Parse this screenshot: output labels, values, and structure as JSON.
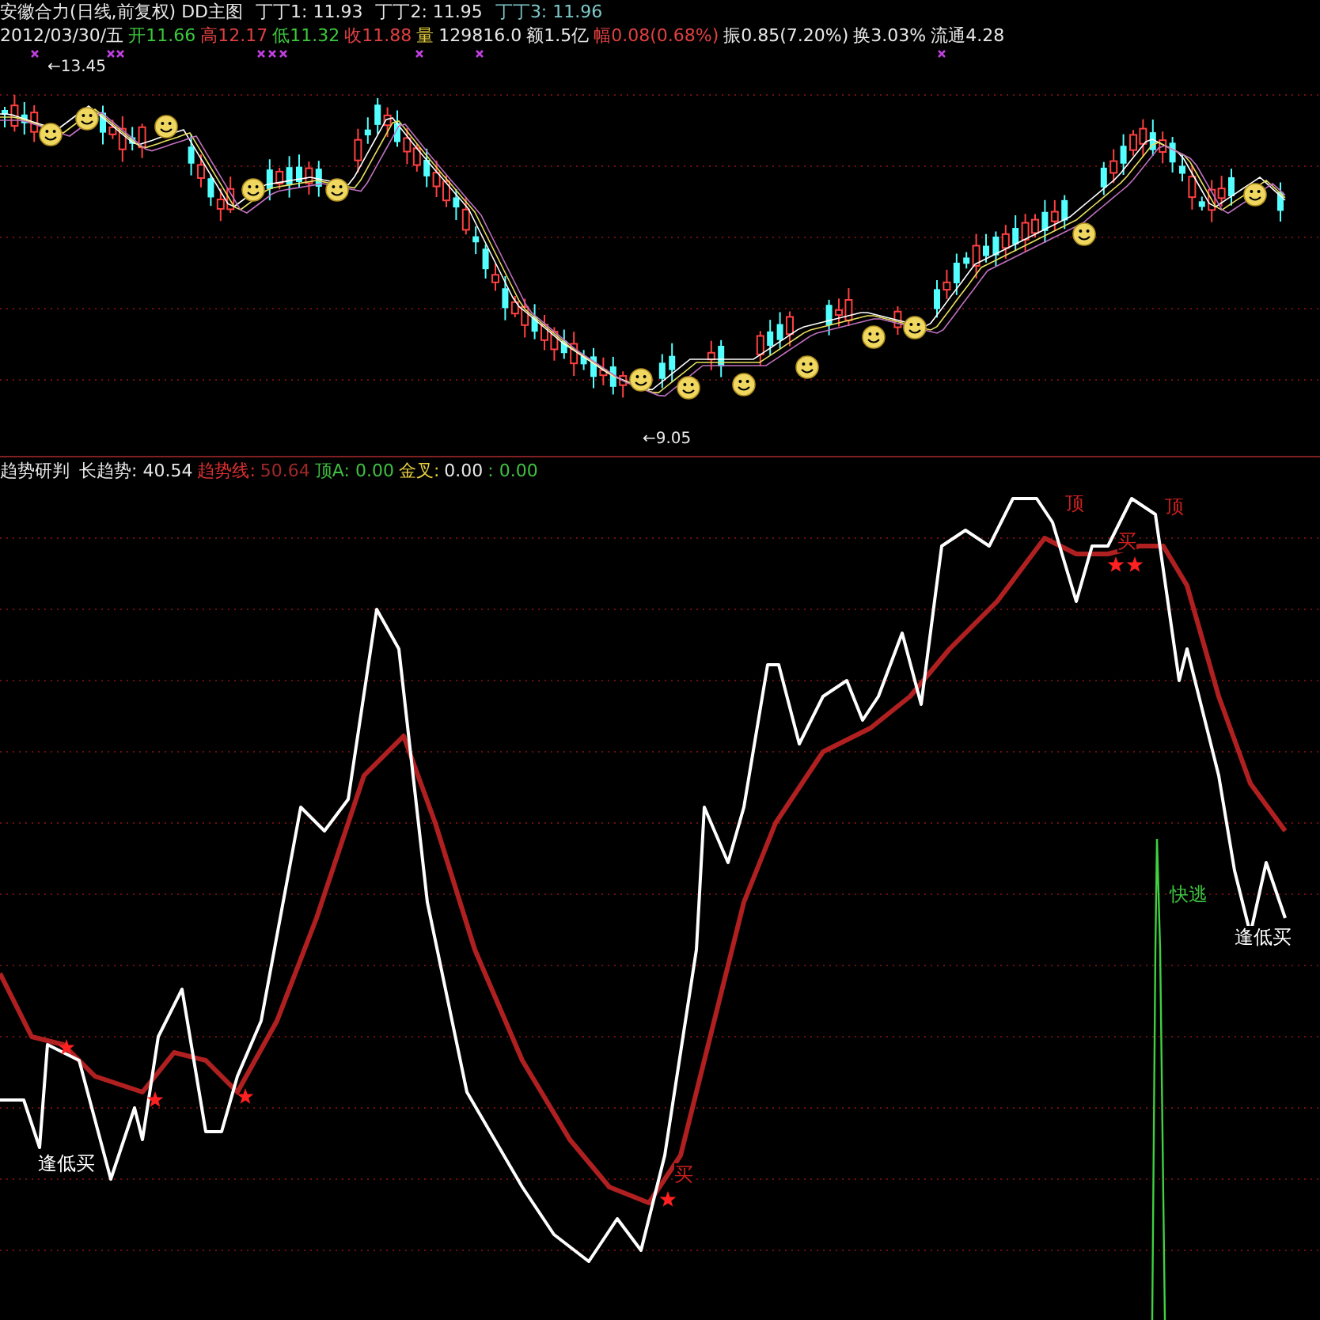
{
  "main_chart": {
    "title": "安徽合力(日线,前复权) DD主图",
    "legend": [
      {
        "text": "丁丁1: 11.93",
        "color": "#e8e8e8"
      },
      {
        "text": "丁丁2: 11.95",
        "color": "#e8e8e8"
      },
      {
        "text": "丁丁3: 11.96",
        "color": "#7fc8c8"
      }
    ],
    "quote": [
      {
        "text": "2012/03/30/五",
        "color": "#e8e8e8"
      },
      {
        "text": "开11.66",
        "color": "#3cc83c"
      },
      {
        "text": "高12.17",
        "color": "#e04040"
      },
      {
        "text": "低11.32",
        "color": "#3cc83c"
      },
      {
        "text": "收11.88",
        "color": "#e04040"
      },
      {
        "text": "量",
        "color": "#e8d040"
      },
      {
        "text": "129816.0",
        "color": "#e8e8e8"
      },
      {
        "text": "额1.5亿",
        "color": "#e8e8e8"
      },
      {
        "text": "幅0.08(0.68%)",
        "color": "#e04040"
      },
      {
        "text": "振0.85(7.20%)",
        "color": "#e8e8e8"
      },
      {
        "text": "换3.03%",
        "color": "#e8e8e8"
      },
      {
        "text": "流通4.28",
        "color": "#e8e8e8"
      }
    ],
    "price_labels": [
      "←13.45",
      "←9.05"
    ]
  },
  "indicator": {
    "title": "趋势研判",
    "items": [
      {
        "text": "长趋势: 40.54",
        "color": "#e8e8e8"
      },
      {
        "text": "趋势线:",
        "color": "#e03030"
      },
      {
        "text": "50.64",
        "color": "#a02828"
      },
      {
        "text": "顶A: 0.00",
        "color": "#40c040"
      },
      {
        "text": "金叉:",
        "color": "#e8d040"
      },
      {
        "text": "0.00",
        "color": "#e8e8e8"
      },
      {
        "text": ": 0.00",
        "color": "#40c040"
      }
    ],
    "annotations": [
      {
        "text": "顶",
        "color": "#d02020"
      },
      {
        "text": "顶",
        "color": "#d02020"
      },
      {
        "text": "买",
        "color": "#d02020"
      },
      {
        "text": "快逃",
        "color": "#40c040"
      },
      {
        "text": "逢低买",
        "color": "#ffffff"
      },
      {
        "text": "逢低买",
        "color": "#ffffff"
      },
      {
        "text": "买",
        "color": "#d02020"
      }
    ]
  }
}
